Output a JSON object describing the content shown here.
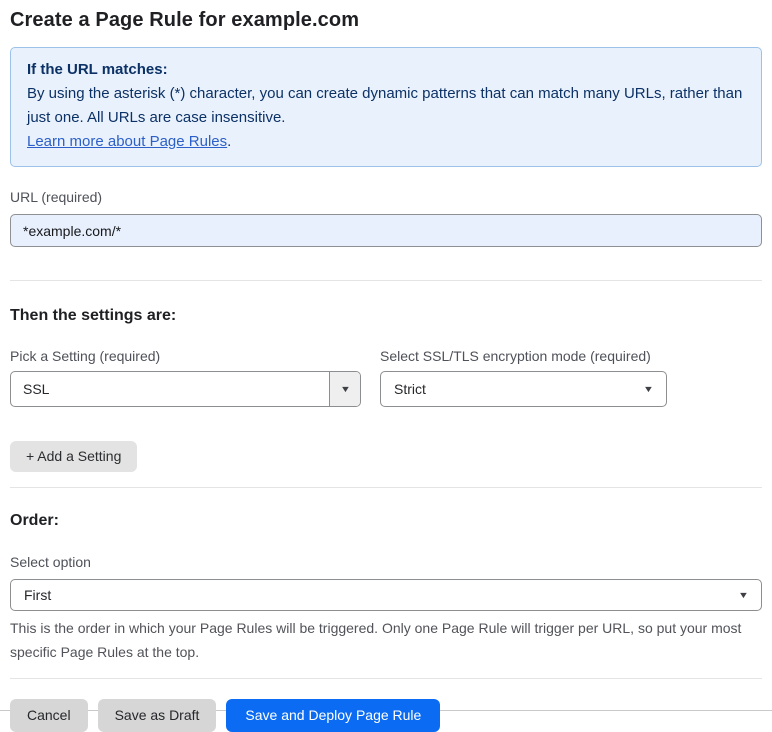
{
  "page": {
    "title": "Create a Page Rule for example.com"
  },
  "callout": {
    "heading": "If the URL matches:",
    "body": "By using the asterisk (*) character, you can create dynamic patterns that can match many URLs, rather than just one. All URLs are case insensitive.",
    "link_label": "Learn more about Page Rules",
    "link_suffix": "."
  },
  "url_field": {
    "label": "URL (required)",
    "value": "*example.com/*"
  },
  "settings_section": {
    "heading": "Then the settings are:",
    "setting_picker": {
      "label": "Pick a Setting (required)",
      "value": "SSL"
    },
    "mode_picker": {
      "label": "Select SSL/TLS encryption mode (required)",
      "value": "Strict"
    },
    "add_setting_label": "+ Add a Setting"
  },
  "order_section": {
    "heading": "Order:",
    "select_label": "Select option",
    "value": "First",
    "help_text": "This is the order in which your Page Rules will be triggered. Only one Page Rule will trigger per URL, so put your most specific Page Rules at the top."
  },
  "footer": {
    "cancel_label": "Cancel",
    "save_draft_label": "Save as Draft",
    "save_deploy_label": "Save and Deploy Page Rule"
  },
  "icons": {
    "dropdown_arrow": "▼"
  },
  "colors": {
    "primary_blue": "#0b6cf3",
    "callout_bg": "#e9f2fc",
    "callout_border": "#9dc2ea",
    "callout_text": "#0c3166",
    "link_blue": "#2c5fc7",
    "input_autofill_bg": "#e8f0fe",
    "button_gray": "#d6d6d6",
    "button_light_gray": "#e3e3e3",
    "label_gray": "#4f5159"
  }
}
